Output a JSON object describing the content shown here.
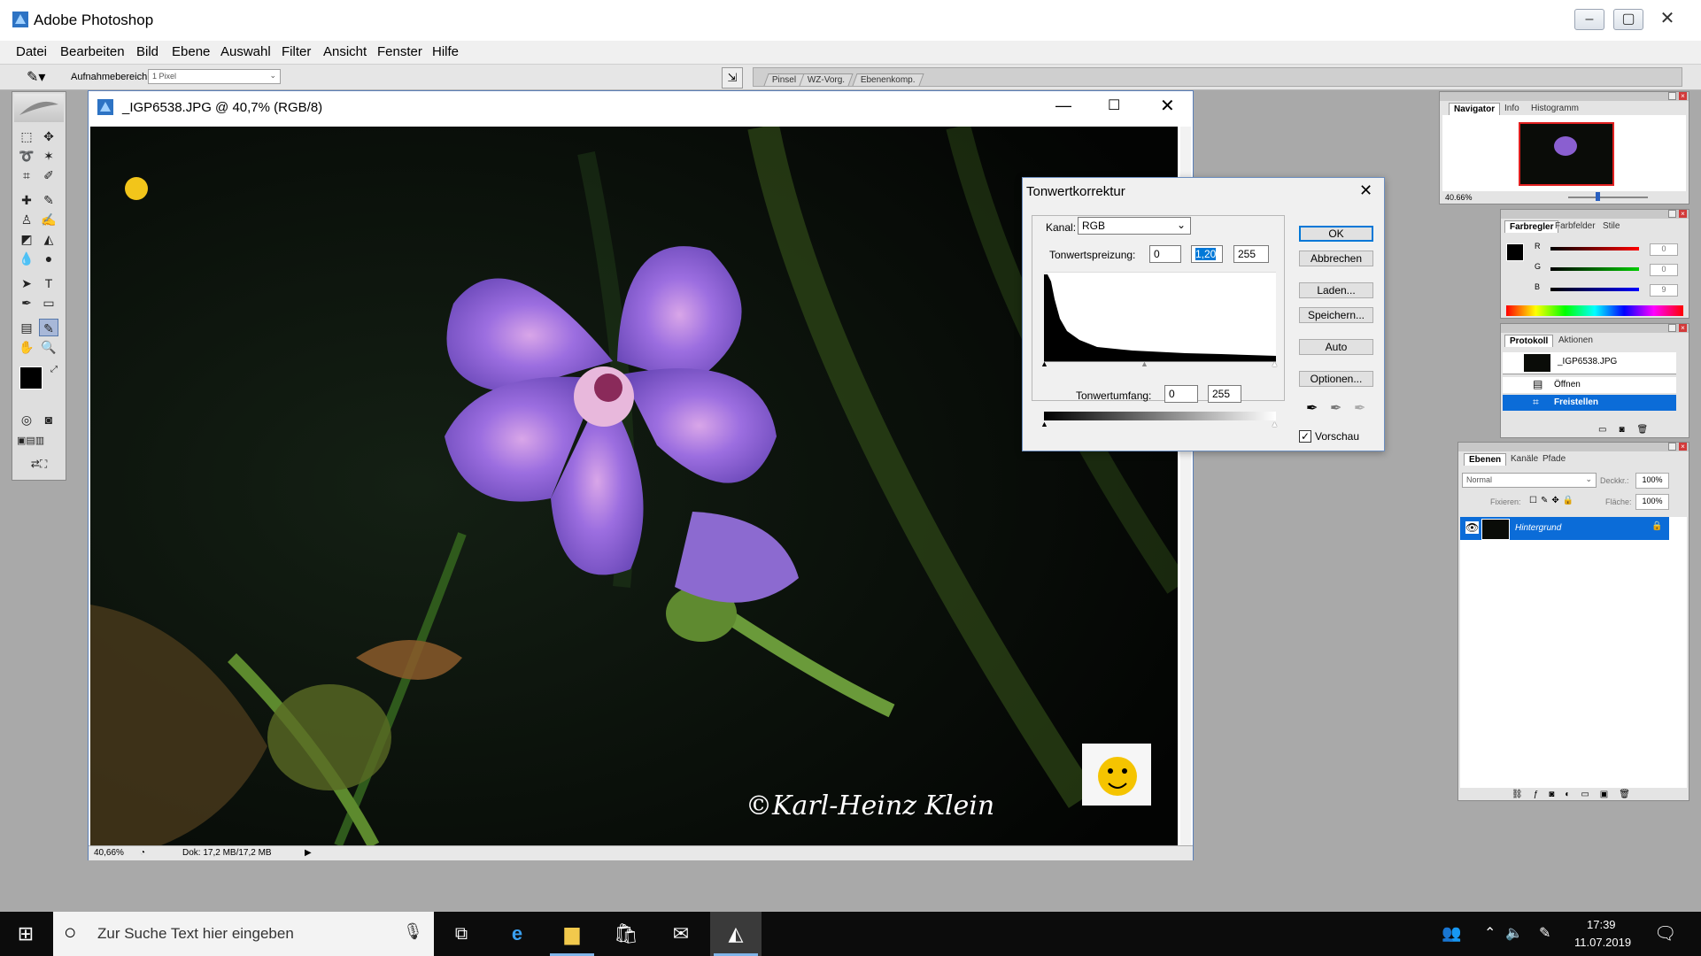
{
  "app": {
    "title": "Adobe Photoshop"
  },
  "menu": [
    "Datei",
    "Bearbeiten",
    "Bild",
    "Ebene",
    "Auswahl",
    "Filter",
    "Ansicht",
    "Fenster",
    "Hilfe"
  ],
  "options": {
    "label": "Aufnahmebereich:",
    "value": "1 Pixel"
  },
  "dock_tabs": [
    "Pinsel",
    "WZ-Vorg.",
    "Ebenenkomp."
  ],
  "document": {
    "title": "_IGP6538.JPG @ 40,7% (RGB/8)",
    "zoom": "40,66%",
    "doc_size": "Dok: 17,2 MB/17,2 MB",
    "watermark": "©Karl-Heinz Klein"
  },
  "navigator": {
    "tabs": [
      "Navigator",
      "Info",
      "Histogramm"
    ],
    "zoom": "40.66%"
  },
  "color": {
    "tabs": [
      "Farbregler",
      "Farbfelder",
      "Stile"
    ],
    "channels": [
      {
        "name": "R",
        "value": "0"
      },
      {
        "name": "G",
        "value": "0"
      },
      {
        "name": "B",
        "value": "9"
      }
    ]
  },
  "history": {
    "tabs": [
      "Protokoll",
      "Aktionen"
    ],
    "snapshot": "_IGP6538.JPG",
    "items": [
      "Öffnen",
      "Freistellen"
    ]
  },
  "layers": {
    "tabs": [
      "Ebenen",
      "Kanäle",
      "Pfade"
    ],
    "blend_mode": "Normal",
    "opacity_label": "Deckkr.:",
    "opacity": "100%",
    "lock_label": "Fixieren:",
    "fill_label": "Fläche:",
    "fill": "100%",
    "layer_name": "Hintergrund"
  },
  "levels_dialog": {
    "title": "Tonwertkorrektur",
    "channel_label": "Kanal:",
    "channel": "RGB",
    "input_label": "Tonwertspreizung:",
    "input_black": "0",
    "input_gamma": "1,20",
    "input_white": "255",
    "output_label": "Tonwertumfang:",
    "output_black": "0",
    "output_white": "255",
    "buttons": {
      "ok": "OK",
      "cancel": "Abbrechen",
      "load": "Laden...",
      "save": "Speichern...",
      "auto": "Auto",
      "options": "Optionen..."
    },
    "preview_label": "Vorschau"
  },
  "taskbar": {
    "search_placeholder": "Zur Suche Text hier eingeben",
    "time": "17:39",
    "date": "11.07.2019"
  },
  "colors": {
    "selection": "#0b6cd8",
    "flower": "#8a5fd0",
    "dialog_accent": "#0078d7"
  }
}
